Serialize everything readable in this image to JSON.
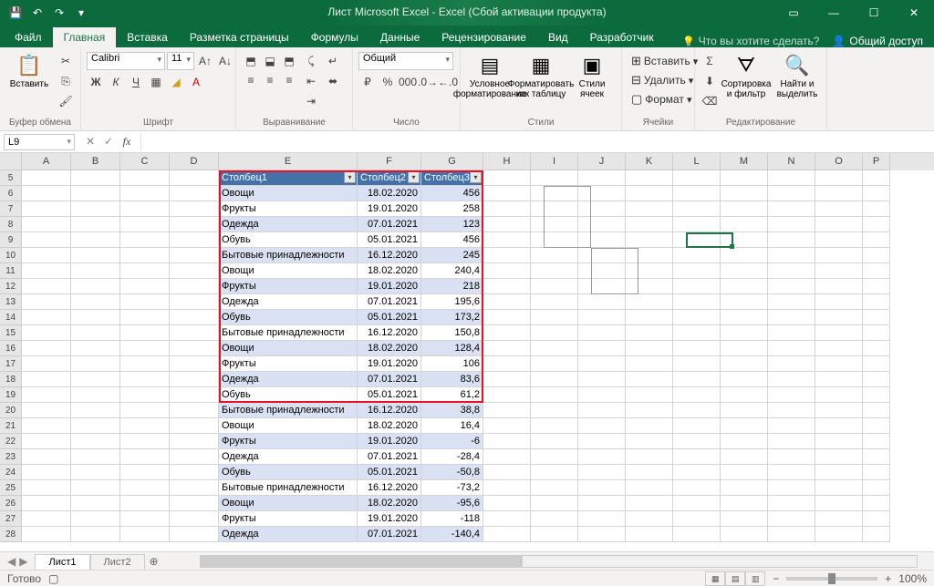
{
  "title": "Лист Microsoft Excel - Excel (Сбой активации продукта)",
  "qat": {
    "save": "💾",
    "undo": "↶",
    "redo": "↷",
    "more": "▾"
  },
  "tabs": {
    "file": "Файл",
    "home": "Главная",
    "insert": "Вставка",
    "layout": "Разметка страницы",
    "formulas": "Формулы",
    "data": "Данные",
    "review": "Рецензирование",
    "view": "Вид",
    "developer": "Разработчик",
    "tellme": "Что вы хотите сделать?",
    "share": "Общий доступ"
  },
  "ribbon": {
    "clipboard": {
      "label": "Буфер обмена",
      "paste": "Вставить"
    },
    "font": {
      "label": "Шрифт",
      "name": "Calibri",
      "size": "11"
    },
    "align": {
      "label": "Выравнивание"
    },
    "number": {
      "label": "Число",
      "format": "Общий"
    },
    "styles": {
      "label": "Стили",
      "cond": "Условное форматирование",
      "table": "Форматировать как таблицу",
      "cell": "Стили ячеек"
    },
    "cells": {
      "label": "Ячейки",
      "insert": "Вставить",
      "delete": "Удалить",
      "format": "Формат"
    },
    "editing": {
      "label": "Редактирование",
      "sort": "Сортировка и фильтр",
      "find": "Найти и выделить"
    }
  },
  "namebox": "L9",
  "columns": [
    "A",
    "B",
    "C",
    "D",
    "E",
    "F",
    "G",
    "H",
    "I",
    "J",
    "K",
    "L",
    "M",
    "N",
    "O",
    "P"
  ],
  "table_headers": [
    "Столбец1",
    "Столбец2",
    "Столбец3"
  ],
  "rows": [
    {
      "n": 5,
      "hdr": true
    },
    {
      "n": 6,
      "e": "Овощи",
      "f": "18.02.2020",
      "g": "456",
      "b": 1
    },
    {
      "n": 7,
      "e": "Фрукты",
      "f": "19.01.2020",
      "g": "258",
      "b": 0
    },
    {
      "n": 8,
      "e": "Одежда",
      "f": "07.01.2021",
      "g": "123",
      "b": 1
    },
    {
      "n": 9,
      "e": "Обувь",
      "f": "05.01.2021",
      "g": "456",
      "b": 0
    },
    {
      "n": 10,
      "e": "Бытовые принадлежности",
      "f": "16.12.2020",
      "g": "245",
      "b": 1
    },
    {
      "n": 11,
      "e": "Овощи",
      "f": "18.02.2020",
      "g": "240,4",
      "b": 0
    },
    {
      "n": 12,
      "e": "Фрукты",
      "f": "19.01.2020",
      "g": "218",
      "b": 1
    },
    {
      "n": 13,
      "e": "Одежда",
      "f": "07.01.2021",
      "g": "195,6",
      "b": 0
    },
    {
      "n": 14,
      "e": "Обувь",
      "f": "05.01.2021",
      "g": "173,2",
      "b": 1
    },
    {
      "n": 15,
      "e": "Бытовые принадлежности",
      "f": "16.12.2020",
      "g": "150,8",
      "b": 0
    },
    {
      "n": 16,
      "e": "Овощи",
      "f": "18.02.2020",
      "g": "128,4",
      "b": 1
    },
    {
      "n": 17,
      "e": "Фрукты",
      "f": "19.01.2020",
      "g": "106",
      "b": 0
    },
    {
      "n": 18,
      "e": "Одежда",
      "f": "07.01.2021",
      "g": "83,6",
      "b": 1
    },
    {
      "n": 19,
      "e": "Обувь",
      "f": "05.01.2021",
      "g": "61,2",
      "b": 0
    },
    {
      "n": 20,
      "e": "Бытовые принадлежности",
      "f": "16.12.2020",
      "g": "38,8",
      "b": 1
    },
    {
      "n": 21,
      "e": "Овощи",
      "f": "18.02.2020",
      "g": "16,4",
      "b": 0
    },
    {
      "n": 22,
      "e": "Фрукты",
      "f": "19.01.2020",
      "g": "-6",
      "b": 1
    },
    {
      "n": 23,
      "e": "Одежда",
      "f": "07.01.2021",
      "g": "-28,4",
      "b": 0
    },
    {
      "n": 24,
      "e": "Обувь",
      "f": "05.01.2021",
      "g": "-50,8",
      "b": 1
    },
    {
      "n": 25,
      "e": "Бытовые принадлежности",
      "f": "16.12.2020",
      "g": "-73,2",
      "b": 0
    },
    {
      "n": 26,
      "e": "Овощи",
      "f": "18.02.2020",
      "g": "-95,6",
      "b": 1
    },
    {
      "n": 27,
      "e": "Фрукты",
      "f": "19.01.2020",
      "g": "-118",
      "b": 0
    },
    {
      "n": 28,
      "e": "Одежда",
      "f": "07.01.2021",
      "g": "-140,4",
      "b": 1
    }
  ],
  "sheets": {
    "s1": "Лист1",
    "s2": "Лист2"
  },
  "status": {
    "ready": "Готово",
    "zoom": "100%"
  }
}
